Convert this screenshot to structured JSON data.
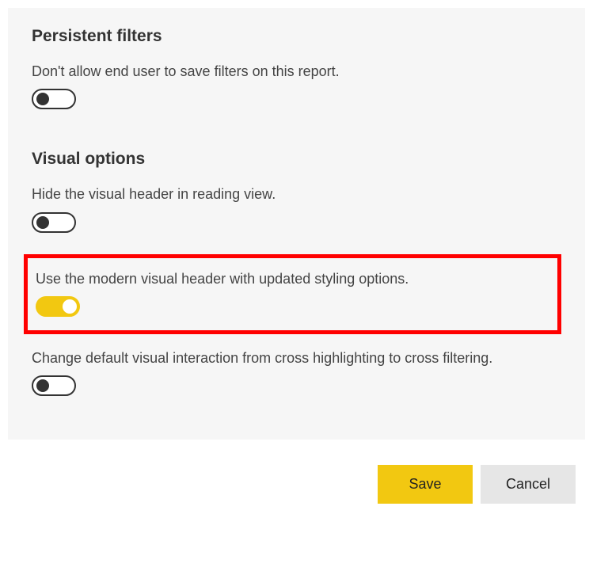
{
  "sections": {
    "persistent_filters": {
      "heading": "Persistent filters",
      "items": {
        "disallow_save": {
          "label": "Don't allow end user to save filters on this report.",
          "on": false
        }
      }
    },
    "visual_options": {
      "heading": "Visual options",
      "items": {
        "hide_header": {
          "label": "Hide the visual header in reading view.",
          "on": false
        },
        "modern_header": {
          "label": "Use the modern visual header with updated styling options.",
          "on": true,
          "highlighted": true
        },
        "cross_filtering": {
          "label": "Change default visual interaction from cross highlighting to cross filtering.",
          "on": false
        }
      }
    }
  },
  "buttons": {
    "save": "Save",
    "cancel": "Cancel"
  },
  "colors": {
    "accent": "#f2c811",
    "highlight_border": "#ff0000"
  }
}
